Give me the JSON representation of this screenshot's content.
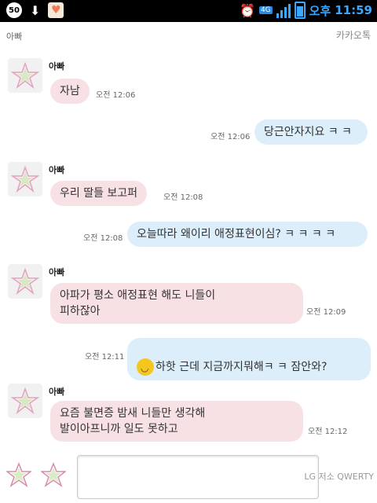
{
  "status": {
    "badge": "50",
    "network": "4G",
    "ampm": "오후",
    "time": "11:59"
  },
  "header": {
    "title": "아빠",
    "brand": "카카오톡"
  },
  "messages": [
    {
      "sender": "아빠",
      "text": "자남",
      "time": "오전 12:06"
    },
    {
      "text": "당근안자지요 ㅋ ㅋ",
      "time": "오전 12:06"
    },
    {
      "sender": "아빠",
      "text": "우리 딸들  보고퍼",
      "time": "오전 12:08"
    },
    {
      "text": "오늘따라 왜이리 애정표현이심? ㅋ ㅋ ㅋ ㅋ",
      "time": "오전 12:08"
    },
    {
      "sender": "아빠",
      "text": "아파가 평소  애정표현  해도  니들이\n피하잖아",
      "time": "오전 12:09"
    },
    {
      "text": "하핫 근데 지금까지뭐해ㅋ ㅋ 잠안와?",
      "time": "오전 12:11"
    },
    {
      "sender": "아빠",
      "text": "요즘 불면증  밤새 니들만  생각해\n발이아프니까  일도 못하고",
      "time": "오전 12:12"
    }
  ],
  "input": {
    "corner_text": "LG 저소 QWERTY"
  }
}
